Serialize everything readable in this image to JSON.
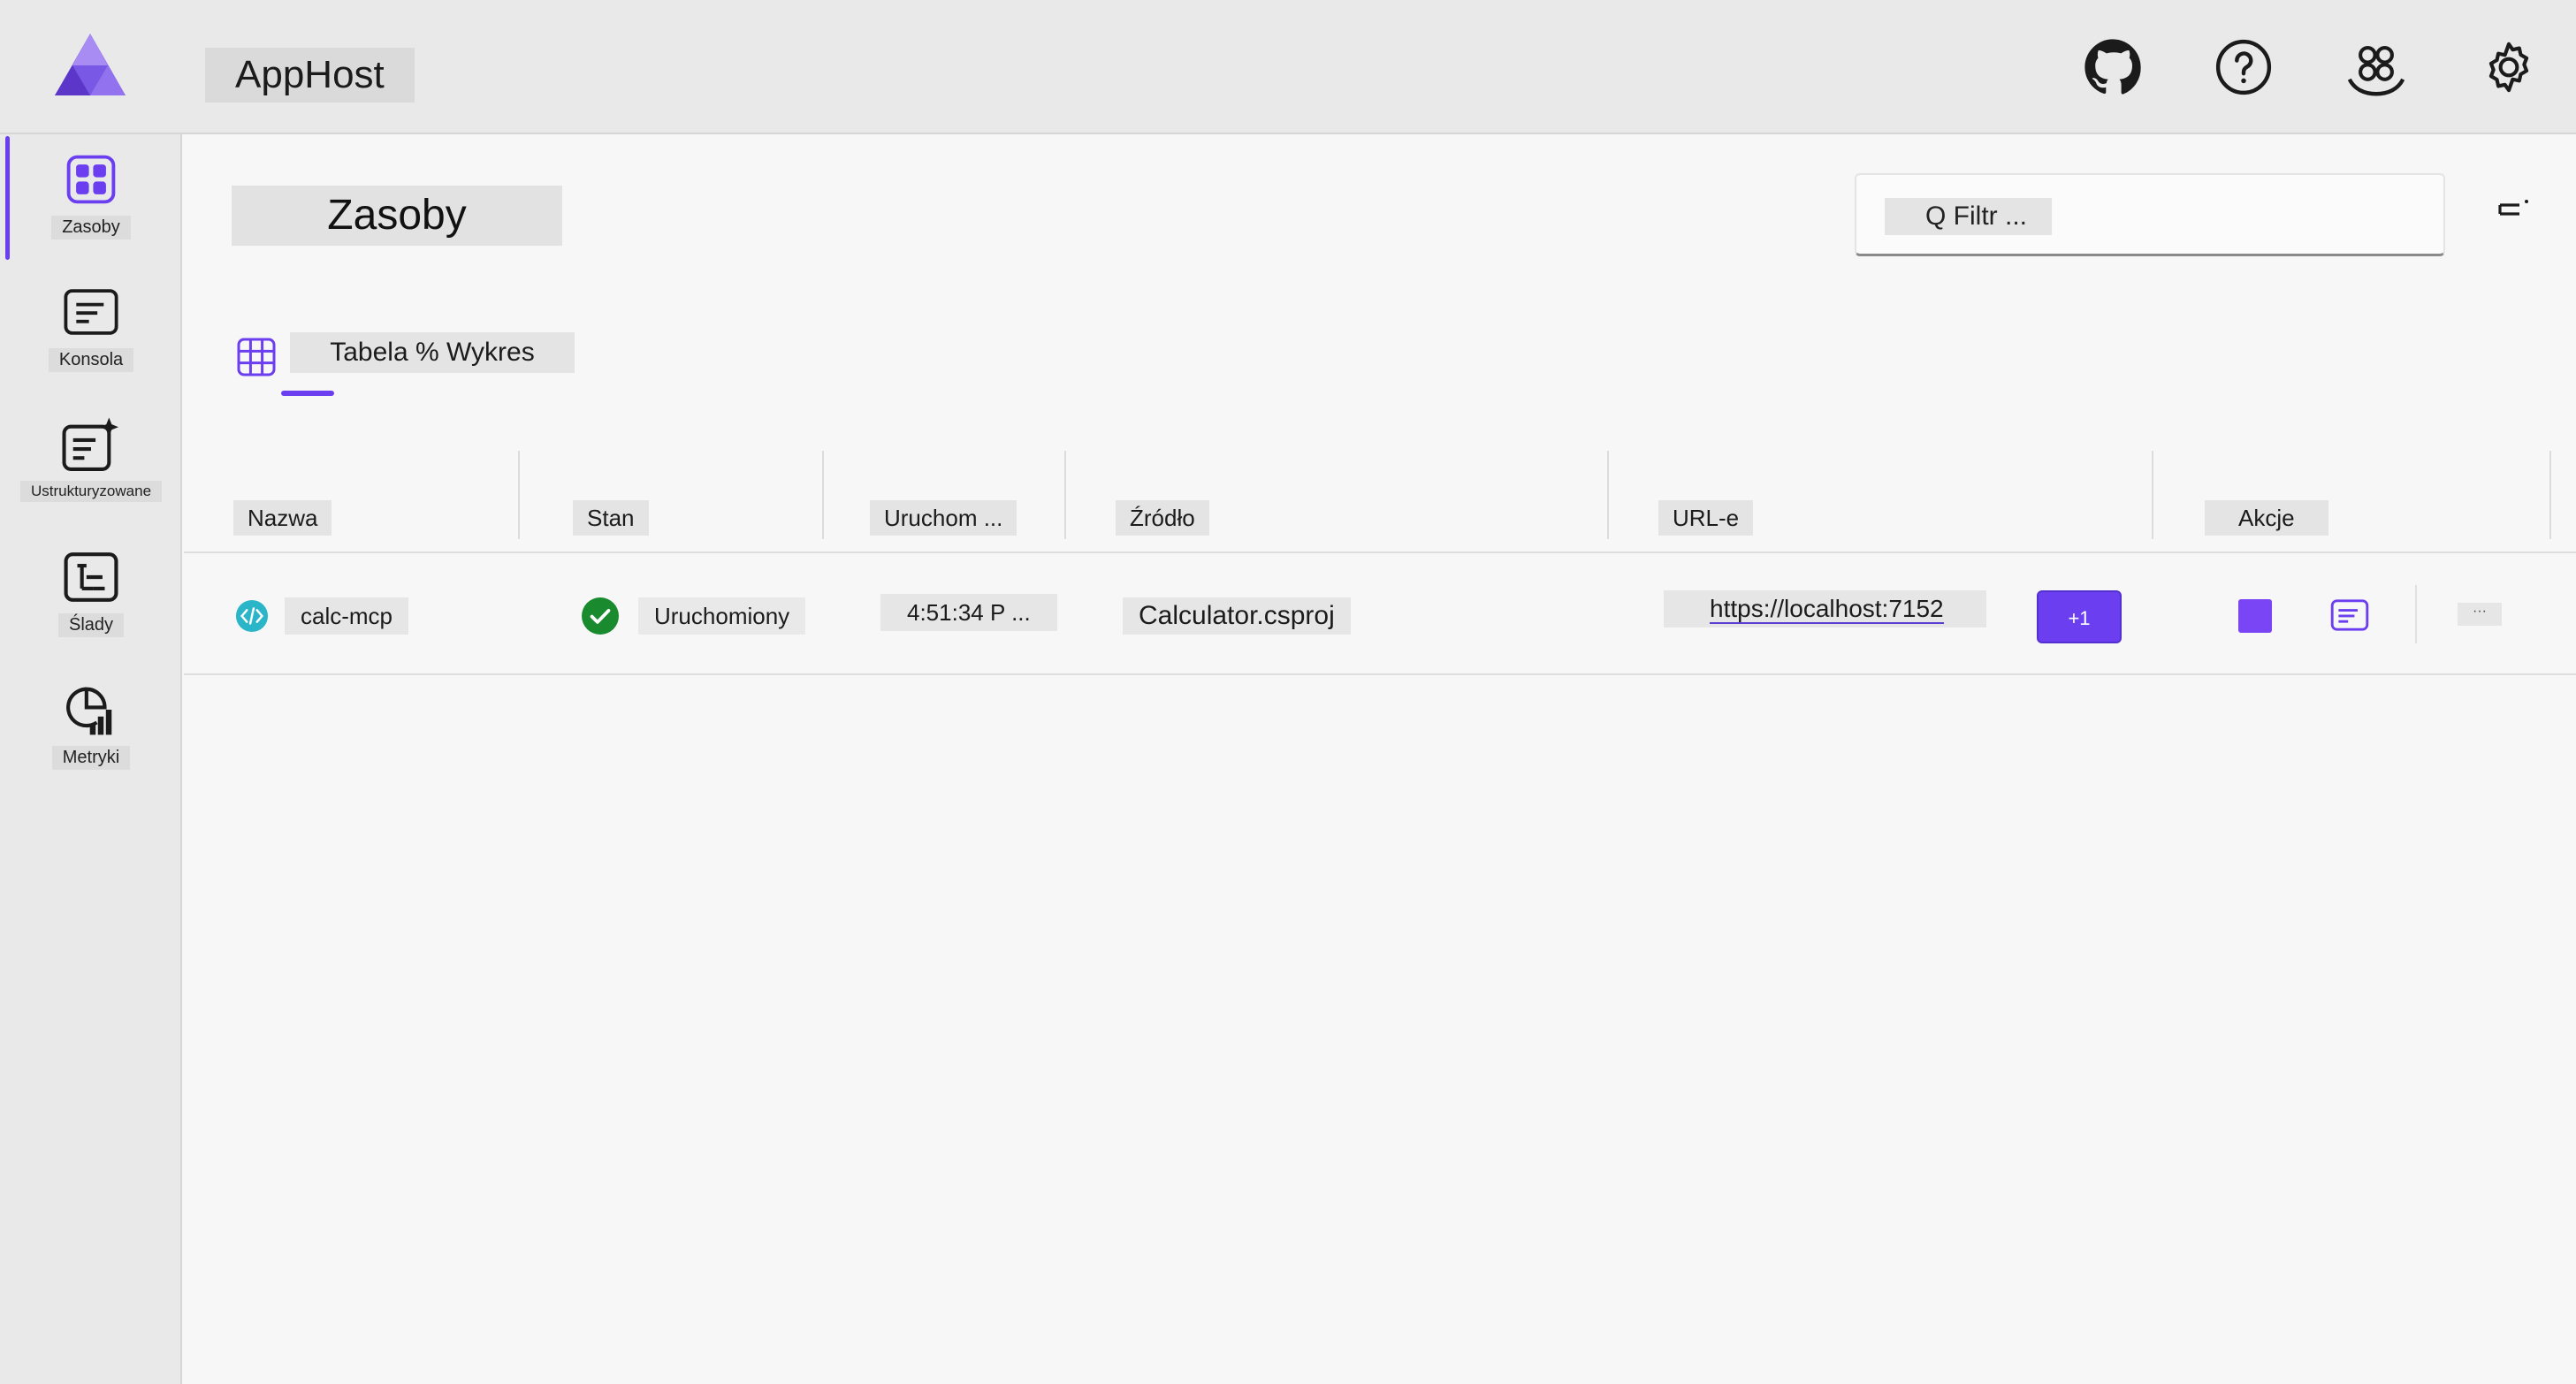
{
  "header": {
    "app_title": "AppHost",
    "icons": [
      "github-icon",
      "help-icon",
      "teams-icon",
      "settings-icon"
    ]
  },
  "sidebar": {
    "items": [
      {
        "label": "Zasoby",
        "icon": "resources-icon",
        "active": true
      },
      {
        "label": "Konsola",
        "icon": "console-icon",
        "active": false
      },
      {
        "label": "Ustrukturyzowane",
        "icon": "structured-logs-icon",
        "active": false
      },
      {
        "label": "Ślady",
        "icon": "traces-icon",
        "active": false
      },
      {
        "label": "Metryki",
        "icon": "metrics-icon",
        "active": false
      }
    ]
  },
  "main": {
    "title": "Zasoby",
    "filter_placeholder": "Q Filtr ...",
    "view_toggle": "Tabela % Wykres",
    "columns": [
      "Nazwa",
      "Stan",
      "Uruchom ...",
      "Źródło",
      "URL-e",
      "Akcje"
    ],
    "rows": [
      {
        "name": "calc-mcp",
        "state": "Uruchomiony",
        "started": "4:51:34 P ...",
        "source": "Calculator.csproj",
        "url": "https://localhost:7152",
        "extra_urls": "+1"
      }
    ]
  },
  "colors": {
    "accent": "#6b3ff0",
    "running": "#1a8a2e",
    "project_icon": "#2bb5c8"
  }
}
